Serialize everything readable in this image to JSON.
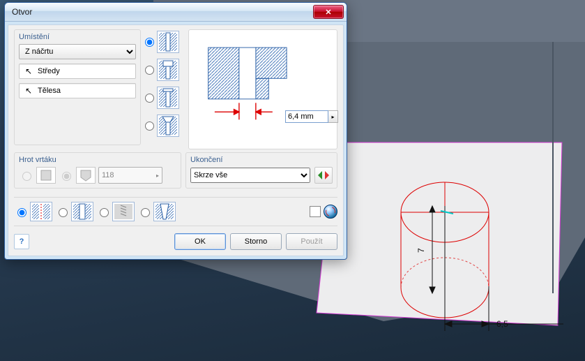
{
  "dialog": {
    "title": "Otvor",
    "placement": {
      "label": "Umístění",
      "mode": "Z náčrtu",
      "centers_label": "Středy",
      "solids_label": "Tělesa"
    },
    "diameter_value": "6,4 mm",
    "drill_point": {
      "label": "Hrot vrtáku",
      "angle": "118"
    },
    "termination": {
      "label": "Ukončení",
      "mode": "Skrze vše"
    },
    "buttons": {
      "ok": "OK",
      "cancel": "Storno",
      "apply": "Použít"
    }
  },
  "sketch": {
    "dim_height": "7",
    "dim_radius": "6,5"
  }
}
